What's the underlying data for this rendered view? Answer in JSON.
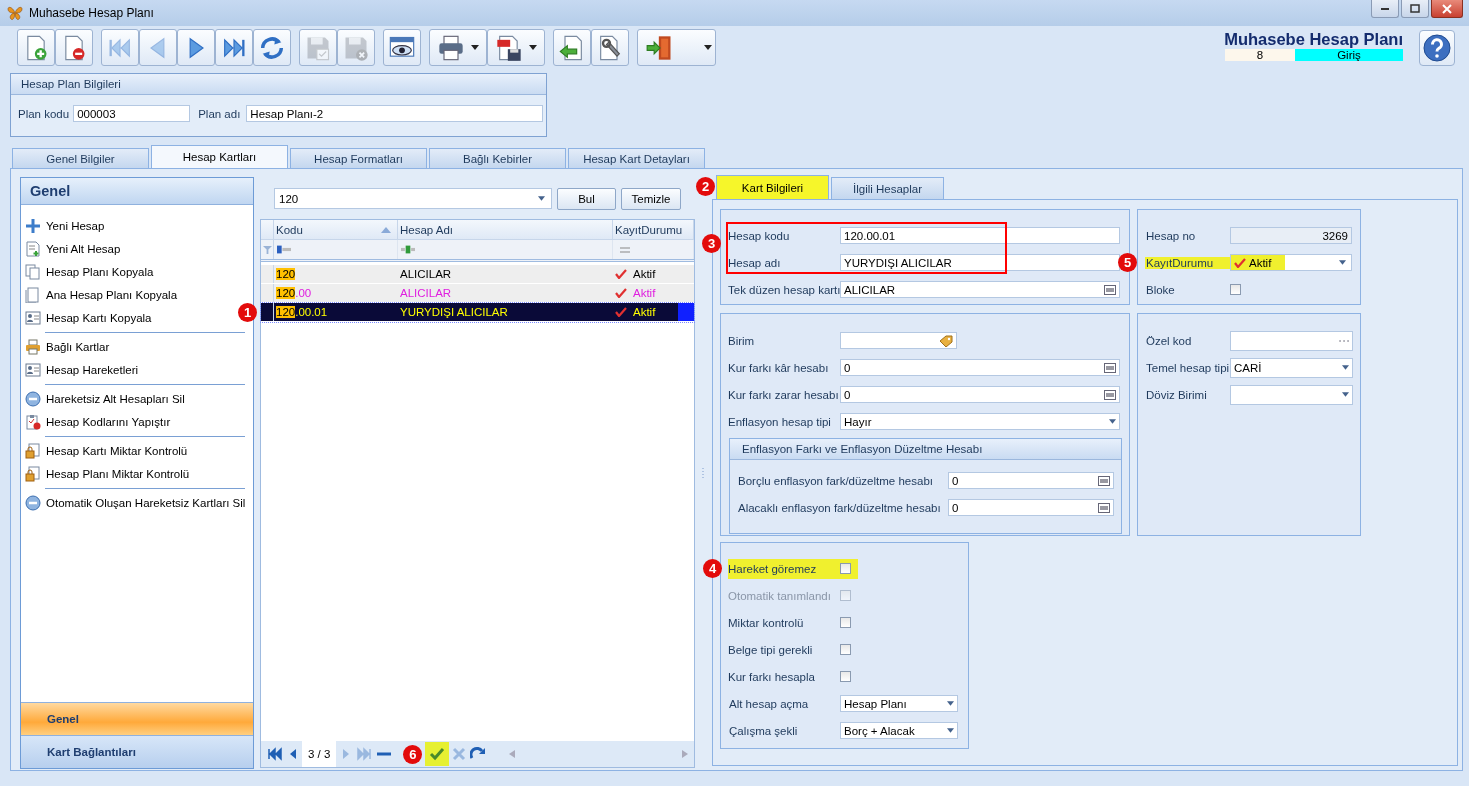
{
  "window": {
    "title": "Muhasebe Hesap Planı"
  },
  "toolbar": [
    [
      {
        "kind": "new",
        "disabled": false,
        "dropdown": false
      },
      {
        "kind": "delete",
        "disabled": false,
        "dropdown": false
      }
    ],
    [
      {
        "kind": "first",
        "disabled": true,
        "dropdown": false
      },
      {
        "kind": "prev",
        "disabled": true,
        "dropdown": false
      },
      {
        "kind": "next",
        "disabled": false,
        "dropdown": false
      },
      {
        "kind": "last",
        "disabled": false,
        "dropdown": false
      },
      {
        "kind": "refresh",
        "disabled": false,
        "dropdown": false
      }
    ],
    [
      {
        "kind": "save",
        "disabled": true,
        "dropdown": false
      },
      {
        "kind": "discard",
        "disabled": true,
        "dropdown": false
      }
    ],
    [
      {
        "kind": "preview",
        "disabled": false,
        "dropdown": false
      }
    ],
    [
      {
        "kind": "print",
        "disabled": false,
        "dropdown": true
      },
      {
        "kind": "pdf",
        "disabled": false,
        "dropdown": true
      }
    ],
    [
      {
        "kind": "import",
        "disabled": false,
        "dropdown": false
      },
      {
        "kind": "settings",
        "disabled": false,
        "dropdown": false
      }
    ],
    [
      {
        "kind": "exit",
        "disabled": false,
        "dropdown": true
      }
    ]
  ],
  "header": {
    "title": "Muhasebe Hesap Planı",
    "user": "8",
    "mode": "Giriş"
  },
  "plan_info": {
    "title": "Hesap Plan Bilgileri",
    "fields": [
      {
        "label": "Plan kodu",
        "value": "000003"
      },
      {
        "label": "Plan adı",
        "value": "Hesap Planı-2"
      }
    ]
  },
  "tabs": [
    {
      "label": "Genel Bilgiler",
      "selected": false
    },
    {
      "label": "Hesap Kartları",
      "selected": true
    },
    {
      "label": "Hesap Formatları",
      "selected": false
    },
    {
      "label": "Bağlı Kebirler",
      "selected": false
    },
    {
      "label": "Hesap Kart Detayları",
      "selected": false
    }
  ],
  "sidebar": {
    "title": "Genel",
    "groups": [
      [
        {
          "label": "Yeni Hesap",
          "kind": "plus"
        },
        {
          "label": "Yeni Alt Hesap",
          "kind": "doc-add"
        },
        {
          "label": "Hesap Planı Kopyala",
          "kind": "copies"
        },
        {
          "label": "Ana Hesap Planı Kopyala",
          "kind": "page"
        },
        {
          "label": "Hesap Kartı Kopyala",
          "kind": "card"
        }
      ],
      [
        {
          "label": "Bağlı Kartlar",
          "kind": "printer"
        },
        {
          "label": "Hesap Hareketleri",
          "kind": "card"
        }
      ],
      [
        {
          "label": "Hareketsiz Alt Hesapları Sil",
          "kind": "minus"
        },
        {
          "label": "Hesap Kodlarını Yapıştır",
          "kind": "clipboard"
        }
      ],
      [
        {
          "label": "Hesap Kartı Miktar Kontrolü",
          "kind": "lock"
        },
        {
          "label": "Hesap Planı Miktar Kontrolü",
          "kind": "lock"
        }
      ],
      [
        {
          "label": "Otomatik Oluşan Hareketsiz Kartları Sil",
          "kind": "minus"
        }
      ]
    ],
    "sections": [
      {
        "label": "Genel",
        "selected": true
      },
      {
        "label": "Kart Bağlantıları",
        "selected": false
      }
    ]
  },
  "search": {
    "value": "120",
    "buttons": [
      "Bul",
      "Temizle"
    ]
  },
  "grid": {
    "columns": [
      {
        "label": "Kodu",
        "sorted": true
      },
      {
        "label": "Hesap Adı",
        "sorted": false
      },
      {
        "label": "KayıtDurumu",
        "sorted": false
      }
    ],
    "rows": [
      {
        "code_match": "120",
        "name": "ALICILAR",
        "status": "Aktif",
        "selected": false,
        "color": "#000000"
      },
      {
        "code_match": "120",
        "code_rest": ".00",
        "name": "ALICILAR",
        "status": "Aktif",
        "selected": false,
        "color": "#e020e0"
      },
      {
        "code_match": "120",
        "code_rest": ".00.01",
        "name": "YURYDIŞI ALICILAR",
        "status": "Aktif",
        "selected": true,
        "callout": "1"
      }
    ]
  },
  "pager": {
    "position": "3 / 3",
    "callout": "6",
    "buttons": [
      {
        "kind": "first",
        "disabled": false,
        "highlighted": false
      },
      {
        "kind": "prev",
        "disabled": false,
        "highlighted": false
      },
      {
        "kind": "position"
      },
      {
        "kind": "next",
        "disabled": true,
        "highlighted": false
      },
      {
        "kind": "last",
        "disabled": true,
        "highlighted": false
      },
      {
        "kind": "remove",
        "disabled": false,
        "highlighted": false
      },
      {
        "kind": "callout"
      },
      {
        "kind": "confirm",
        "disabled": false,
        "highlighted": true
      },
      {
        "kind": "cancel",
        "disabled": true,
        "highlighted": false
      },
      {
        "kind": "undo",
        "disabled": false,
        "highlighted": false
      }
    ]
  },
  "detail_tabs": [
    {
      "label": "Kart Bilgileri",
      "selected": true,
      "highlighted": true,
      "callout": "2"
    },
    {
      "label": "İlgili Hesaplar",
      "selected": false,
      "highlighted": false
    }
  ],
  "card": {
    "callout": "3",
    "outlined_fields": [
      {
        "label": "Hesap kodu",
        "value": "120.00.01"
      },
      {
        "label": "Hesap adı",
        "value": "YURYDIŞI ALICILAR"
      }
    ],
    "fields": [
      {
        "label": "Tek düzen hesap kartı",
        "value": "ALICILAR",
        "kind": "lookup"
      }
    ]
  },
  "status": {
    "number": {
      "label": "Hesap no",
      "value": "3269"
    },
    "record": {
      "label": "KayıtDurumu",
      "value": "Aktif",
      "highlighted": true,
      "callout": "5"
    },
    "blocked": {
      "label": "Bloke",
      "checked": false
    }
  },
  "accounts": {
    "fields": [
      {
        "label": "Birim",
        "kind": "tag"
      },
      {
        "label": "Kur farkı kâr hesabı",
        "value": "0",
        "kind": "lookup"
      },
      {
        "label": "Kur farkı zarar hesabı",
        "value": "0",
        "kind": "lookup"
      },
      {
        "label": "Enflasyon hesap tipi",
        "value": "Hayır",
        "kind": "dropdown"
      }
    ],
    "inflation": {
      "title": "Enflasyon Farkı ve Enflasyon Düzeltme Hesabı",
      "fields": [
        {
          "label": "Borçlu enflasyon fark/düzeltme hesabı",
          "value": "0",
          "kind": "lookup"
        },
        {
          "label": "Alacaklı enflasyon fark/düzeltme hesabı",
          "value": "0",
          "kind": "lookup"
        }
      ]
    }
  },
  "codes": {
    "fields": [
      {
        "label": "Özel kod",
        "kind": "ellipsis"
      },
      {
        "label": "Temel hesap tipi",
        "value": "CARİ",
        "kind": "dropdown"
      },
      {
        "label": "Döviz Birimi",
        "kind": "dropdown"
      }
    ]
  },
  "flags": {
    "checks": [
      {
        "label": "Hareket göremez",
        "checked": false,
        "disabled": false,
        "highlighted": true,
        "callout": "4"
      },
      {
        "label": "Otomatik tanımlandı",
        "checked": false,
        "disabled": true,
        "highlighted": false
      },
      {
        "label": "Miktar kontrolü",
        "checked": false,
        "disabled": false,
        "highlighted": false
      },
      {
        "label": "Belge tipi gerekli",
        "checked": false,
        "disabled": false,
        "highlighted": false
      },
      {
        "label": "Kur farkı hesapla",
        "checked": false,
        "disabled": false,
        "highlighted": false
      }
    ],
    "selects": [
      {
        "label": "Alt hesap açma",
        "value": "Hesap Planı"
      },
      {
        "label": "Çalışma şekli",
        "value": "Borç + Alacak"
      }
    ]
  }
}
